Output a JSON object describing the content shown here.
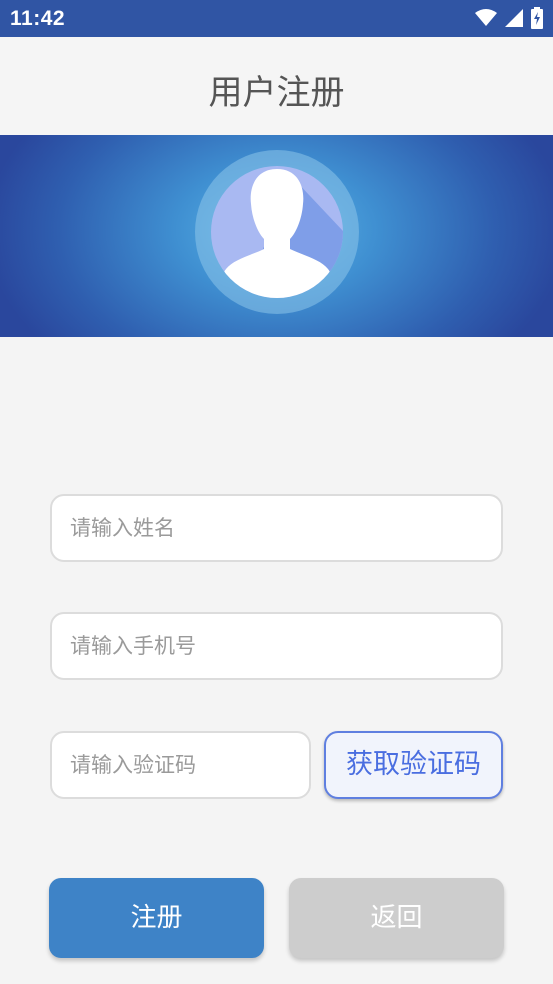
{
  "status": {
    "time": "11:42"
  },
  "header": {
    "title": "用户注册"
  },
  "form": {
    "name_placeholder": "请输入姓名",
    "phone_placeholder": "请输入手机号",
    "code_placeholder": "请输入验证码",
    "get_code_label": "获取验证码"
  },
  "actions": {
    "register_label": "注册",
    "back_label": "返回"
  },
  "icons": [
    "wifi-icon",
    "signal-icon",
    "battery-icon",
    "avatar-icon"
  ],
  "colors": {
    "status_bar": "#3055a4",
    "primary_button": "#3e83c7",
    "secondary_button": "#cdcdcd",
    "code_button_border": "#5f7fe0"
  }
}
